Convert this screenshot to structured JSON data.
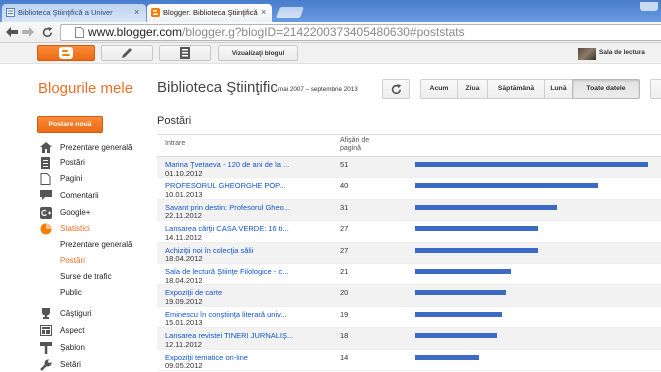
{
  "browser": {
    "tabs": [
      {
        "title": "Biblioteca Ştiinţifică a Univer",
        "close": "×",
        "icon": "site-favicon",
        "active": false
      },
      {
        "title": "Blogger: Biblioteca Ştiinţifică",
        "close": "×",
        "icon": "blogger-favicon",
        "active": true
      }
    ],
    "nav_icons": [
      "back-arrow-icon",
      "forward-arrow-icon",
      "reload-icon"
    ],
    "url_host": "www.blogger.com",
    "url_path": "/blogger.g?blogID=2142200373405480630#poststats"
  },
  "toolbar": {
    "icons": [
      "blogger-logo-icon",
      "pencil-icon",
      "pages-icon"
    ],
    "view_blog": "Vizualizaţi blogul",
    "user_name": "Sala de lectura"
  },
  "header": {
    "my_blogs": "Blogurile mele",
    "blog_title": "Biblioteca Ştiinţific",
    "date_range": "mai 2007 – septembrie 2013",
    "refresh_icon": "refresh-icon",
    "ranges": [
      {
        "label": "Acum",
        "selected": false
      },
      {
        "label": "Ziua",
        "selected": false
      },
      {
        "label": "Săptămână",
        "selected": false
      },
      {
        "label": "Lună",
        "selected": false
      },
      {
        "label": "Toate datele",
        "selected": true
      }
    ]
  },
  "sidebar": {
    "new_post": "Postare nouă",
    "items_top": [
      {
        "label": "Prezentare generală",
        "icon": "home-icon",
        "selected": false
      },
      {
        "label": "Postări",
        "icon": "posts-icon",
        "selected": false
      },
      {
        "label": "Pagini",
        "icon": "page-icon",
        "selected": false
      },
      {
        "label": "Comentarii",
        "icon": "comment-icon",
        "selected": false
      },
      {
        "label": "Google+",
        "icon": "google-plus-icon",
        "selected": false
      },
      {
        "label": "Statistici",
        "icon": "stats-icon",
        "selected": true
      }
    ],
    "stats_subitems": [
      {
        "label": "Prezentare generală",
        "selected": false
      },
      {
        "label": "Postări",
        "selected": true
      },
      {
        "label": "Surse de trafic",
        "selected": false
      },
      {
        "label": "Public",
        "selected": false
      }
    ],
    "items_bottom": [
      {
        "label": "Câştiguri",
        "icon": "trophy-icon"
      },
      {
        "label": "Aspect",
        "icon": "layout-icon"
      },
      {
        "label": "Şablon",
        "icon": "template-icon"
      },
      {
        "label": "Setări",
        "icon": "wrench-icon"
      }
    ]
  },
  "posts": {
    "heading": "Postări",
    "col_entry": "Intrare",
    "col_views": "Afişări de pagină",
    "rows": [
      {
        "title": "Marina Ţvetaeva - 120 de ani de la ...",
        "date": "01.10.2012",
        "views": 51
      },
      {
        "title": "PROFESORUL GHEORGHE POP...",
        "date": "10.01.2013",
        "views": 40
      },
      {
        "title": "Savant prin destin: Profesorul Gheo...",
        "date": "22.11.2012",
        "views": 31
      },
      {
        "title": "Lansarea cărţii CASA VERDE: 16 ti...",
        "date": "14.11.2012",
        "views": 27
      },
      {
        "title": "Achiziţii noi în colecţia sălii",
        "date": "18.04.2012",
        "views": 27
      },
      {
        "title": "Sala de lectură Ştiinţe Filologice - c...",
        "date": "18.04.2012",
        "views": 21
      },
      {
        "title": "Expoziţii de carte",
        "date": "19.09.2012",
        "views": 20
      },
      {
        "title": "Eminescu în conştiinţa literară univ...",
        "date": "15.01.2013",
        "views": 19
      },
      {
        "title": "Lansarea revistei TINERI JURNALIŞ...",
        "date": "12.11.2012",
        "views": 18
      },
      {
        "title": "Expoziţii tematice on-line",
        "date": "09.05.2012",
        "views": 14
      }
    ]
  },
  "colors": {
    "accent": "#e8702a",
    "link": "#1155cc",
    "bar": "#3b6bc5",
    "tab_bar": "#5a8ad6"
  }
}
